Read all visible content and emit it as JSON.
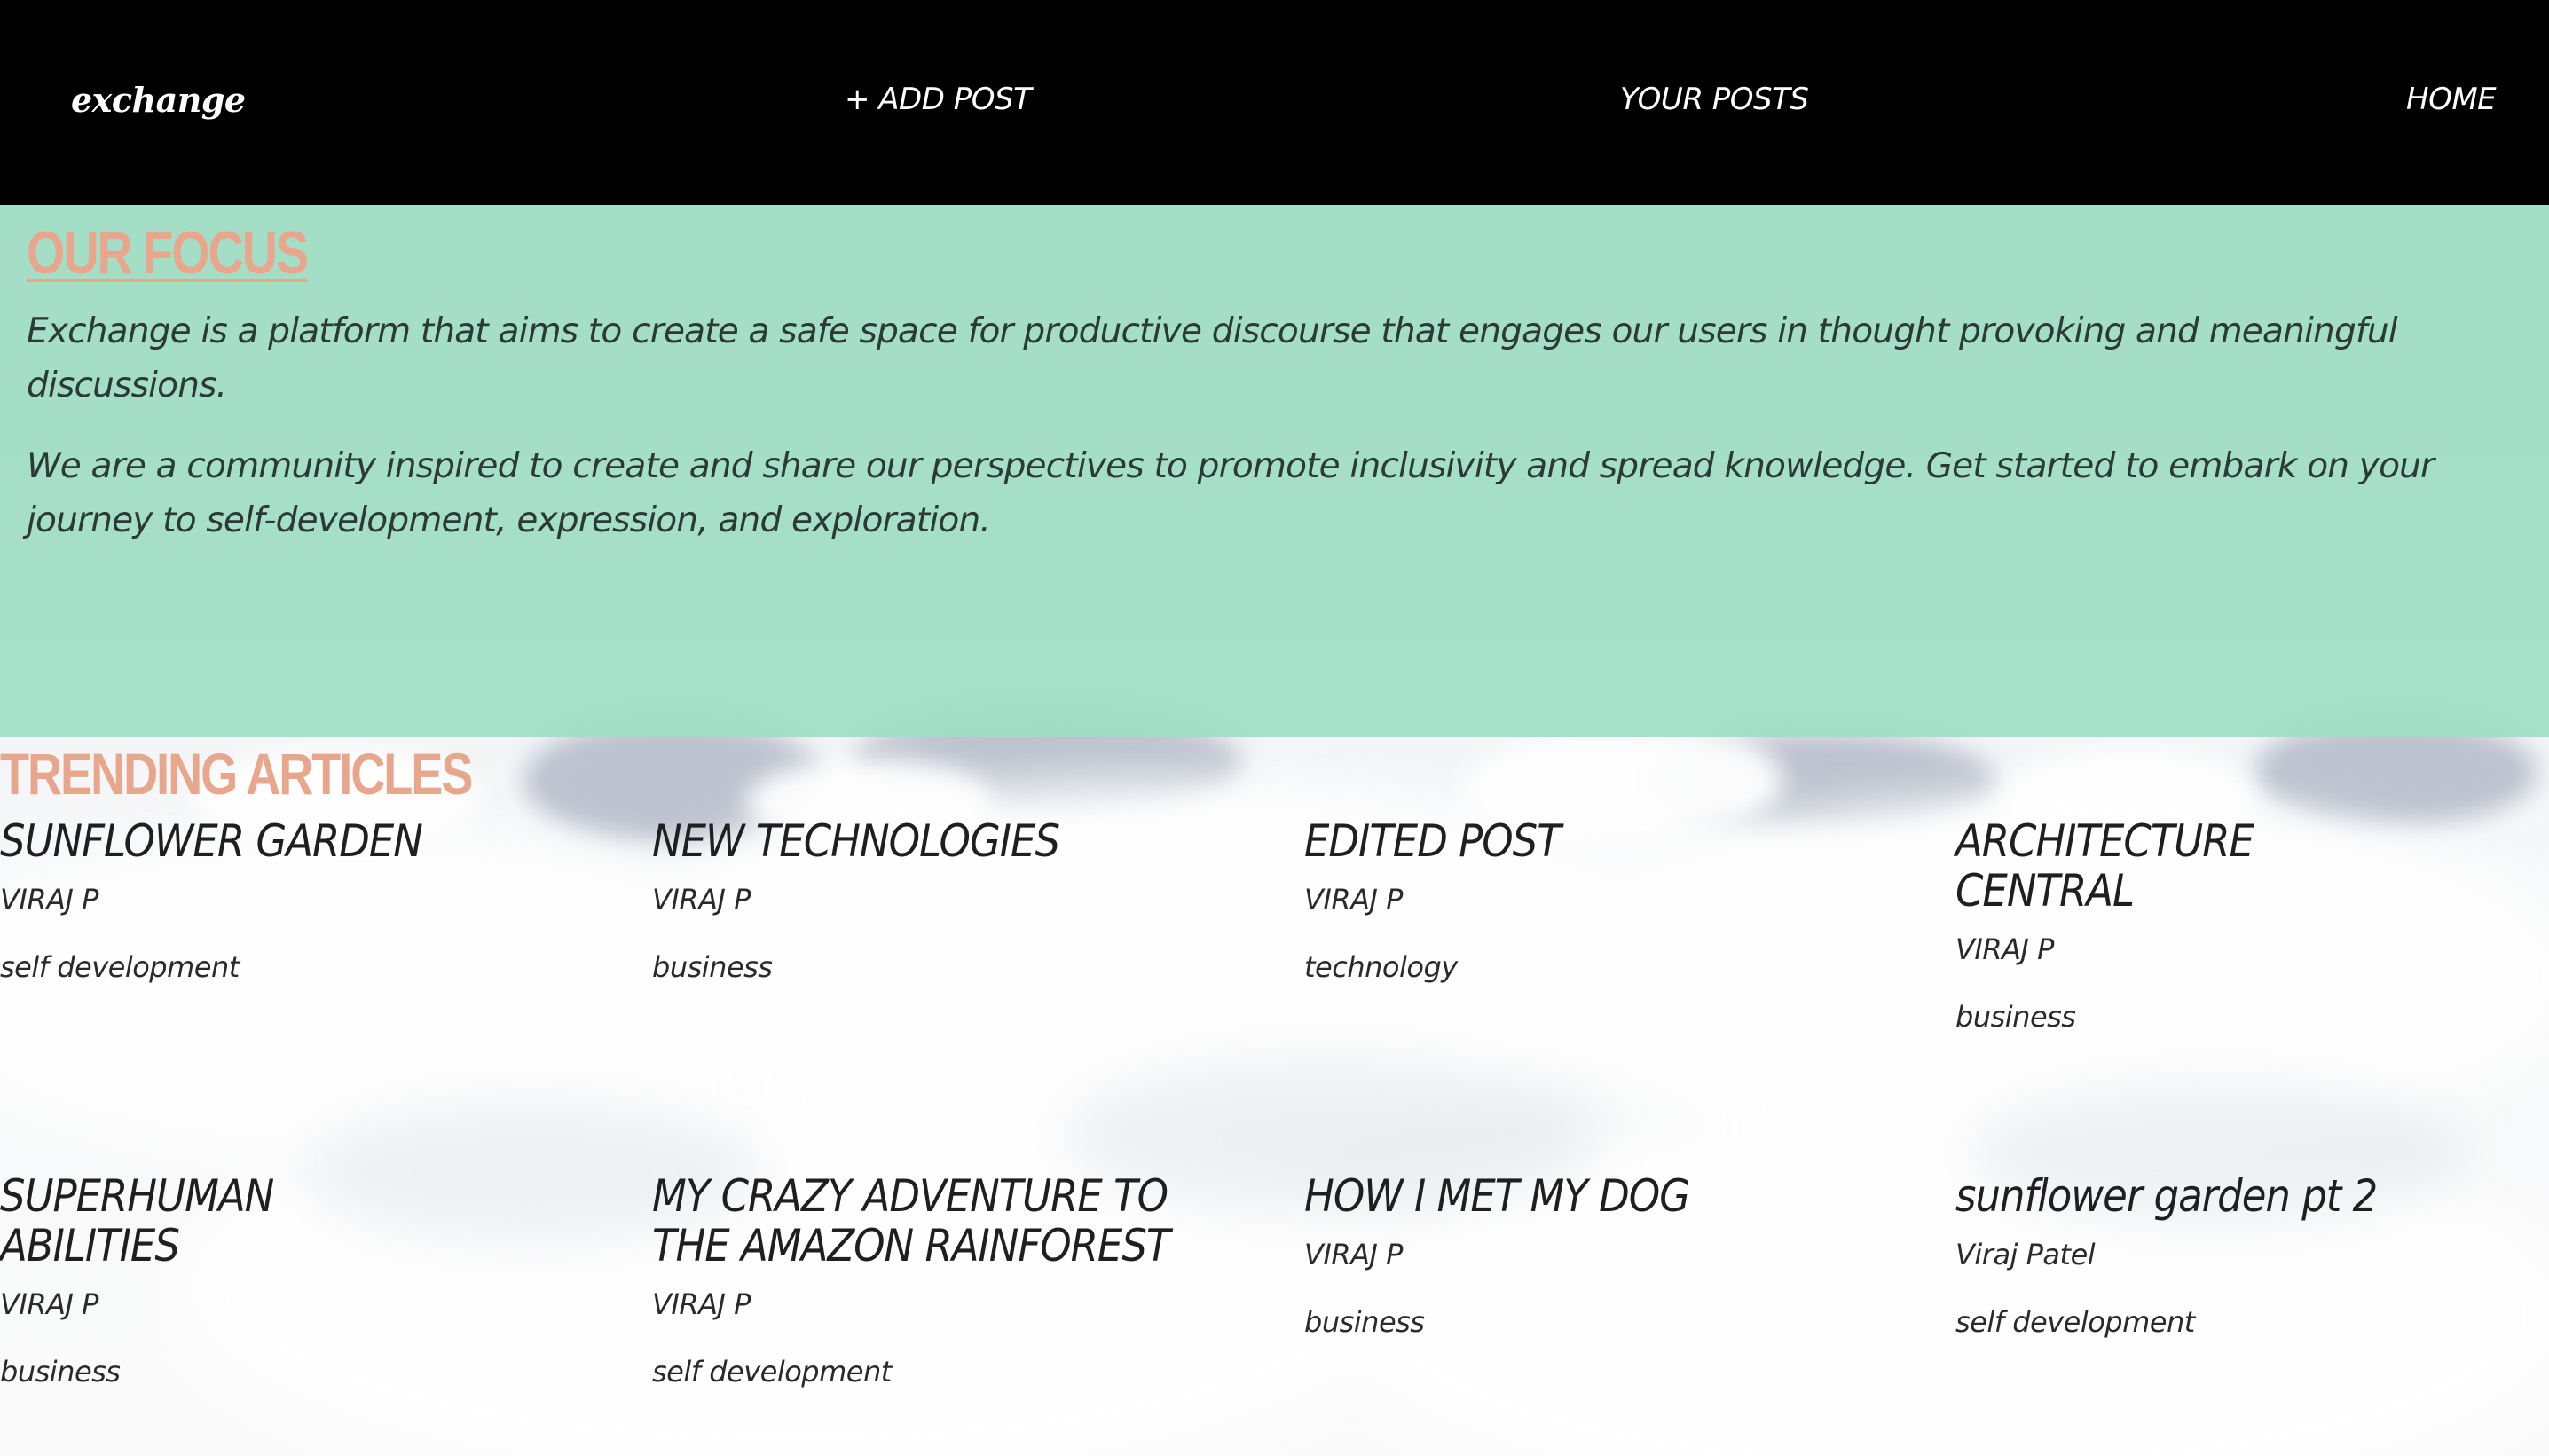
{
  "navbar": {
    "brand": "exchange",
    "links": [
      "+ ADD POST",
      "YOUR POSTS",
      "HOME"
    ]
  },
  "focus": {
    "title": "OUR FOCUS",
    "paragraphs": [
      "Exchange is a platform that aims to create a safe space for productive discourse that engages our users in thought provoking and meaningful discussions.",
      "We are a community inspired to create and share our perspectives to promote inclusivity and spread knowledge. Get started to embark on your journey to self-development, expression, and exploration."
    ]
  },
  "trending": {
    "title": "TRENDING ARTICLES",
    "articles": [
      {
        "title": "SUNFLOWER GARDEN",
        "author": "VIRAJ P",
        "category": "self development"
      },
      {
        "title": "NEW TECHNOLOGIES",
        "author": "VIRAJ P",
        "category": "business"
      },
      {
        "title": "EDITED POST",
        "author": "VIRAJ P",
        "category": "technology"
      },
      {
        "title": "ARCHITECTURE CENTRAL",
        "author": "VIRAJ P",
        "category": "business"
      },
      {
        "title": "SUPERHUMAN ABILITIES",
        "author": "VIRAJ P",
        "category": "business"
      },
      {
        "title": "MY CRAZY ADVENTURE TO THE AMAZON RAINFOREST",
        "author": "VIRAJ P",
        "category": "self development"
      },
      {
        "title": "HOW I MET MY DOG",
        "author": "VIRAJ P",
        "category": "business"
      },
      {
        "title": "sunflower garden pt 2",
        "author": "Viraj Patel",
        "category": "self development"
      }
    ]
  },
  "colors": {
    "navbar_bg": "#000000",
    "focus_bg": "#a0dec4",
    "heading_accent": "#e8a78c",
    "text": "#1f1f1f"
  }
}
